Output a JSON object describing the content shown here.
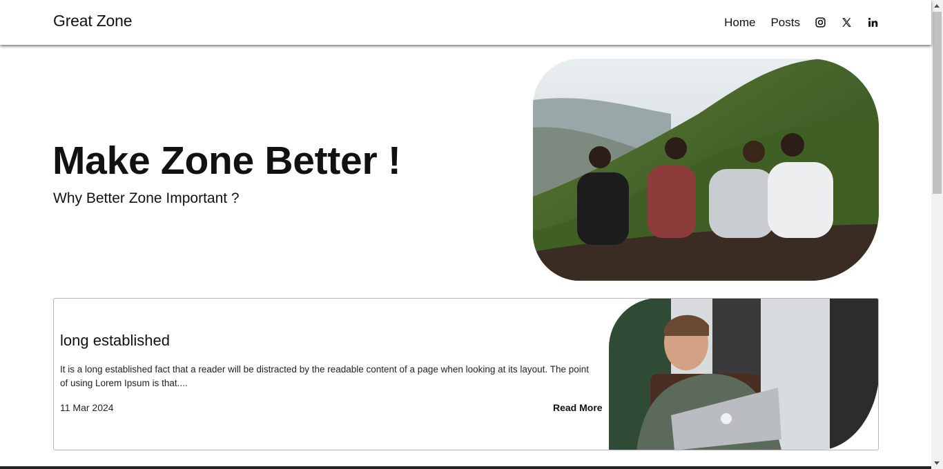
{
  "navbar": {
    "brand": "Great Zone",
    "links": [
      {
        "label": "Home"
      },
      {
        "label": "Posts"
      }
    ],
    "social_icons": [
      "instagram-icon",
      "x-icon",
      "linkedin-icon"
    ]
  },
  "hero": {
    "title": "Make Zone Better !",
    "subtitle": "Why Better Zone Important ?",
    "image_alt": "four-friends-on-mountain-photo"
  },
  "posts": [
    {
      "title": "long established",
      "excerpt": "It is a long established fact that a reader will be distracted by the readable content of a page when looking at its layout. The point of using Lorem Ipsum is that....",
      "date": "11 Mar 2024",
      "read_more": "Read More",
      "image_alt": "man-with-laptop-photo"
    }
  ],
  "colors": {
    "background": "#ffffff",
    "text": "#111111",
    "card_border": "#b5b5b5"
  }
}
